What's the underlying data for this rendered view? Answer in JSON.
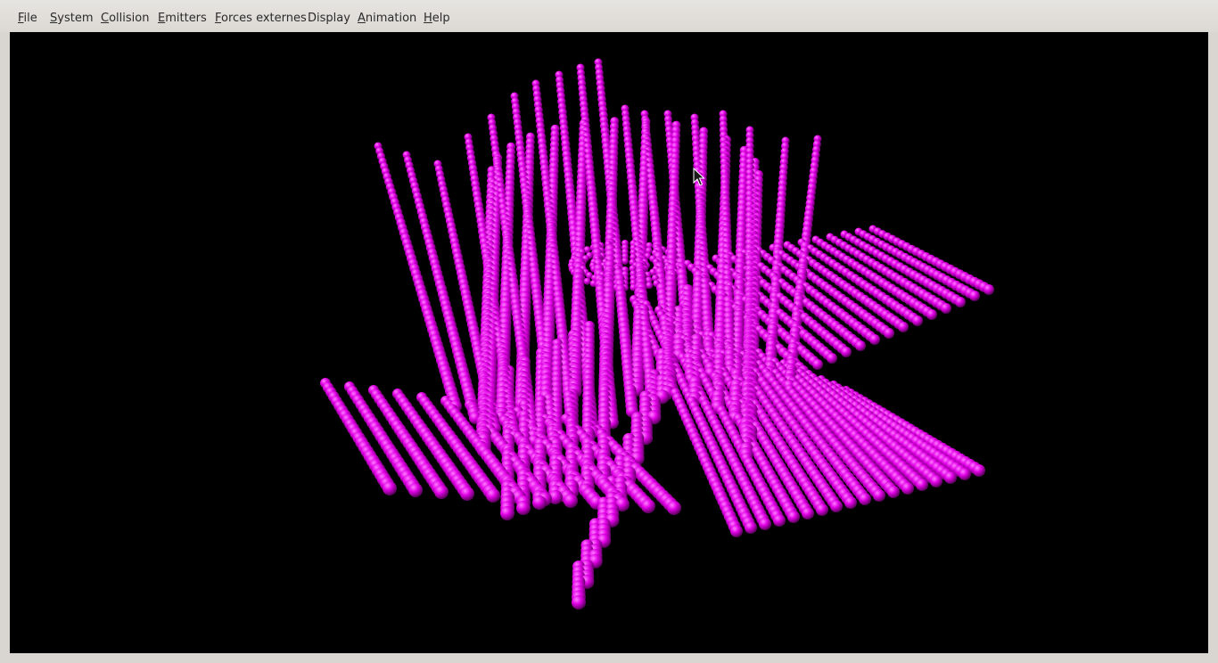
{
  "menubar": {
    "items": [
      {
        "mnemonic": "F",
        "rest": "ile"
      },
      {
        "mnemonic": "S",
        "rest": "ystem"
      },
      {
        "mnemonic": "C",
        "rest": "ollision"
      },
      {
        "mnemonic": "E",
        "rest": "mitters"
      },
      {
        "mnemonic": "F",
        "rest": "orces externes"
      },
      {
        "mnemonic": "",
        "rest": "Display"
      },
      {
        "mnemonic": "A",
        "rest": "nimation"
      },
      {
        "mnemonic": "H",
        "rest": "elp"
      }
    ]
  },
  "viewport": {
    "background": "#000000",
    "particle_color": "#e100e6",
    "particle_highlight": "#ff7dff",
    "particle_shadow": "#5a005c"
  },
  "cursor": {
    "icon": "mouse-pointer-icon"
  }
}
